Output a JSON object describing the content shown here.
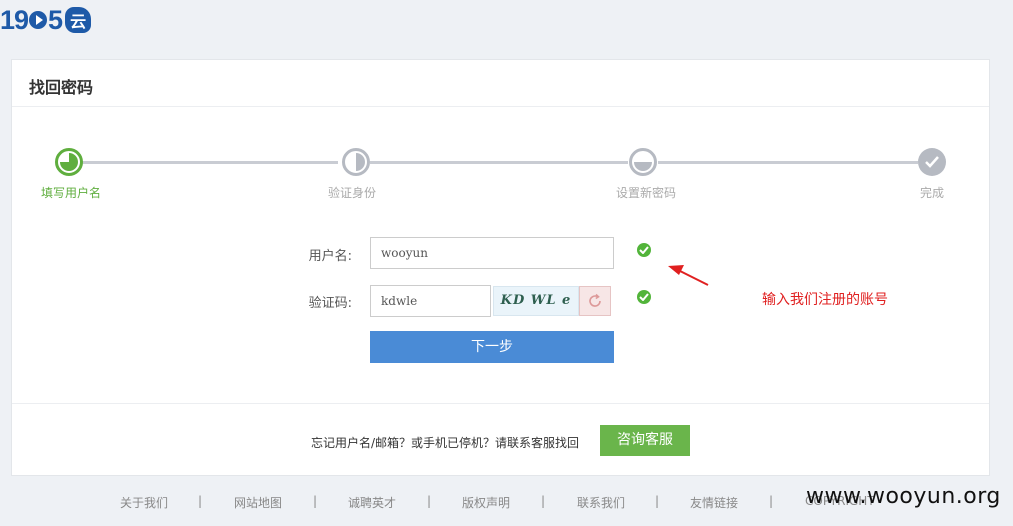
{
  "logo": {
    "text_a": "19",
    "text_b": "5",
    "yun": "云"
  },
  "panel": {
    "title": "找回密码"
  },
  "steps": [
    {
      "label": "填写用户名"
    },
    {
      "label": "验证身份"
    },
    {
      "label": "设置新密码"
    },
    {
      "label": "完成"
    }
  ],
  "form": {
    "username_label": "用户名:",
    "username_value": "wooyun",
    "captcha_label": "验证码:",
    "captcha_value": "kdwle",
    "captcha_image_text": "KD WL e",
    "next_label": "下一步"
  },
  "annotation": "输入我们注册的账号",
  "help": {
    "forgot_text": "忘记用户名/邮箱？或手机已停机？请联系客服找回",
    "consult_label": "咨询客服"
  },
  "footer": [
    "关于我们",
    "|",
    "网站地图",
    "|",
    "诚聘英才",
    "|",
    "版权声明",
    "|",
    "联系我们",
    "|",
    "友情链接",
    "|",
    "COPYRIGHT"
  ],
  "watermark": "www.wooyun.org",
  "colors": {
    "accent_green": "#5fae3e",
    "button_blue": "#4a8bd6",
    "annotation_red": "#e02020"
  }
}
